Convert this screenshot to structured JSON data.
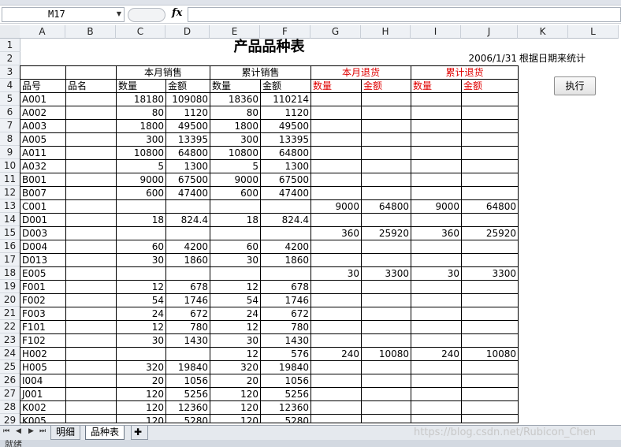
{
  "namebox": {
    "value": "M17"
  },
  "formula": {
    "fx": "fx",
    "value": ""
  },
  "columns": [
    "A",
    "B",
    "C",
    "D",
    "E",
    "F",
    "G",
    "H",
    "I",
    "J",
    "K",
    "L"
  ],
  "rows": [
    "1",
    "2",
    "3",
    "4",
    "5",
    "6",
    "7",
    "8",
    "9",
    "10",
    "11",
    "12",
    "13",
    "14",
    "15",
    "16",
    "17",
    "18",
    "19",
    "20",
    "21",
    "22",
    "23",
    "24",
    "25",
    "26",
    "27",
    "28",
    "29"
  ],
  "sheet": {
    "title": "产品品种表",
    "date": "2006/1/31",
    "date_note": "根据日期来统计",
    "group_headers": {
      "month_sales": "本月销售",
      "cum_sales": "累计销售",
      "month_return": "本月退货",
      "cum_return": "累计退货"
    },
    "col_headers": {
      "code": "品号",
      "name": "品名",
      "qty": "数量",
      "amt": "金额"
    },
    "data": [
      [
        "A001",
        "",
        "18180",
        "109080",
        "18360",
        "110214",
        "",
        "",
        "",
        ""
      ],
      [
        "A002",
        "",
        "80",
        "1120",
        "80",
        "1120",
        "",
        "",
        "",
        ""
      ],
      [
        "A003",
        "",
        "1800",
        "49500",
        "1800",
        "49500",
        "",
        "",
        "",
        ""
      ],
      [
        "A005",
        "",
        "300",
        "13395",
        "300",
        "13395",
        "",
        "",
        "",
        ""
      ],
      [
        "A011",
        "",
        "10800",
        "64800",
        "10800",
        "64800",
        "",
        "",
        "",
        ""
      ],
      [
        "A032",
        "",
        "5",
        "1300",
        "5",
        "1300",
        "",
        "",
        "",
        ""
      ],
      [
        "B001",
        "",
        "9000",
        "67500",
        "9000",
        "67500",
        "",
        "",
        "",
        ""
      ],
      [
        "B007",
        "",
        "600",
        "47400",
        "600",
        "47400",
        "",
        "",
        "",
        ""
      ],
      [
        "C001",
        "",
        "",
        "",
        "",
        "",
        "9000",
        "64800",
        "9000",
        "64800"
      ],
      [
        "D001",
        "",
        "18",
        "824.4",
        "18",
        "824.4",
        "",
        "",
        "",
        ""
      ],
      [
        "D003",
        "",
        "",
        "",
        "",
        "",
        "360",
        "25920",
        "360",
        "25920"
      ],
      [
        "D004",
        "",
        "60",
        "4200",
        "60",
        "4200",
        "",
        "",
        "",
        ""
      ],
      [
        "D013",
        "",
        "30",
        "1860",
        "30",
        "1860",
        "",
        "",
        "",
        ""
      ],
      [
        "E005",
        "",
        "",
        "",
        "",
        "",
        "30",
        "3300",
        "30",
        "3300"
      ],
      [
        "F001",
        "",
        "12",
        "678",
        "12",
        "678",
        "",
        "",
        "",
        ""
      ],
      [
        "F002",
        "",
        "54",
        "1746",
        "54",
        "1746",
        "",
        "",
        "",
        ""
      ],
      [
        "F003",
        "",
        "24",
        "672",
        "24",
        "672",
        "",
        "",
        "",
        ""
      ],
      [
        "F101",
        "",
        "12",
        "780",
        "12",
        "780",
        "",
        "",
        "",
        ""
      ],
      [
        "F102",
        "",
        "30",
        "1430",
        "30",
        "1430",
        "",
        "",
        "",
        ""
      ],
      [
        "H002",
        "",
        "",
        "",
        "12",
        "576",
        "240",
        "10080",
        "240",
        "10080"
      ],
      [
        "H005",
        "",
        "320",
        "19840",
        "320",
        "19840",
        "",
        "",
        "",
        ""
      ],
      [
        "I004",
        "",
        "20",
        "1056",
        "20",
        "1056",
        "",
        "",
        "",
        ""
      ],
      [
        "J001",
        "",
        "120",
        "5256",
        "120",
        "5256",
        "",
        "",
        "",
        ""
      ],
      [
        "K002",
        "",
        "120",
        "12360",
        "120",
        "12360",
        "",
        "",
        "",
        ""
      ],
      [
        "K005",
        "",
        "120",
        "5280",
        "120",
        "5280",
        "",
        "",
        "",
        ""
      ]
    ]
  },
  "button": {
    "run": "执行"
  },
  "tabs": [
    "明细",
    "品种表"
  ],
  "status": "就绪",
  "watermark": "https://blog.csdn.net/Rubicon_Chen"
}
